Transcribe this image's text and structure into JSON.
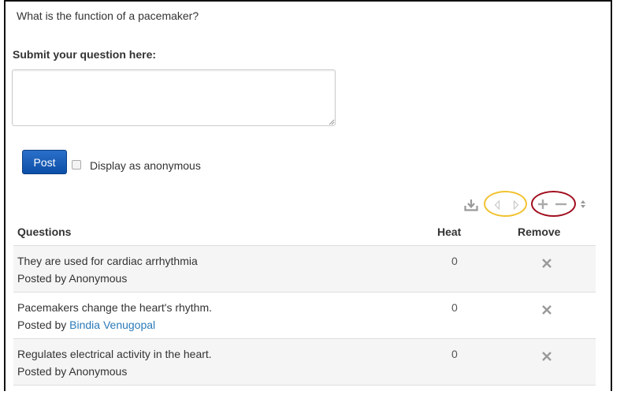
{
  "prompt": {
    "question": "What is the function of a pacemaker?"
  },
  "submit": {
    "label": "Submit your question here:",
    "textarea_value": "",
    "post_label": "Post",
    "anonymous_label": "Display as anonymous",
    "anonymous_checked": false
  },
  "toolbar": {
    "icons": [
      "download-icon",
      "prev-arrow-icon",
      "next-arrow-icon",
      "plus-icon",
      "minus-icon",
      "sort-icon"
    ],
    "highlight_colors": {
      "navigation": "#f2c230",
      "zoom": "#a10f1f"
    }
  },
  "table": {
    "headers": {
      "questions": "Questions",
      "heat": "Heat",
      "remove": "Remove"
    },
    "rows": [
      {
        "text": "They are used for cardiac arrhythmia",
        "posted_by_prefix": "Posted by",
        "poster": "Anonymous",
        "poster_is_link": false,
        "heat": "0"
      },
      {
        "text": "Pacemakers change the heart's rhythm.",
        "posted_by_prefix": "Posted by",
        "poster": "Bindia Venugopal",
        "poster_is_link": true,
        "heat": "0"
      },
      {
        "text": "Regulates electrical activity in the heart.",
        "posted_by_prefix": "Posted by",
        "poster": "Anonymous",
        "poster_is_link": false,
        "heat": "0"
      }
    ]
  },
  "colors": {
    "primary_button": "#0d4fa8",
    "link": "#2a7ab8",
    "row_stripe": "#f5f5f5"
  }
}
